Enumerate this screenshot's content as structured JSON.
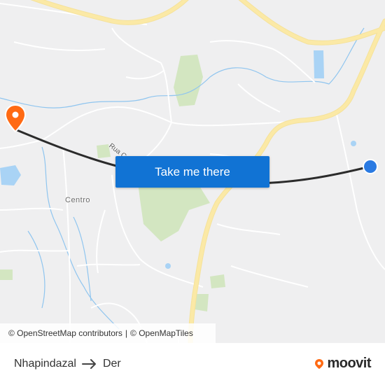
{
  "map": {
    "cta_label": "Take me there",
    "place_labels": {
      "centro": "Centro",
      "rua": "Rua C"
    },
    "attribution": {
      "osm_prefix": "© OpenStreetMap contributors",
      "separator": "|",
      "tiles": "© OpenMapTiles"
    },
    "colors": {
      "background": "#efeff0",
      "major_road": "#fbe9a6",
      "minor_road": "#ffffff",
      "water": "#a9d3f5",
      "park": "#d3e6c1",
      "route_line": "#2b2b2b",
      "origin_dot": "#2a7ae2",
      "destination_pin": "#ff6a13",
      "cta": "#1173d4"
    }
  },
  "footer": {
    "origin": "Nhapindazal",
    "destination": "Der",
    "brand": "moovit",
    "arrow_icon": "arrow-right-icon"
  }
}
